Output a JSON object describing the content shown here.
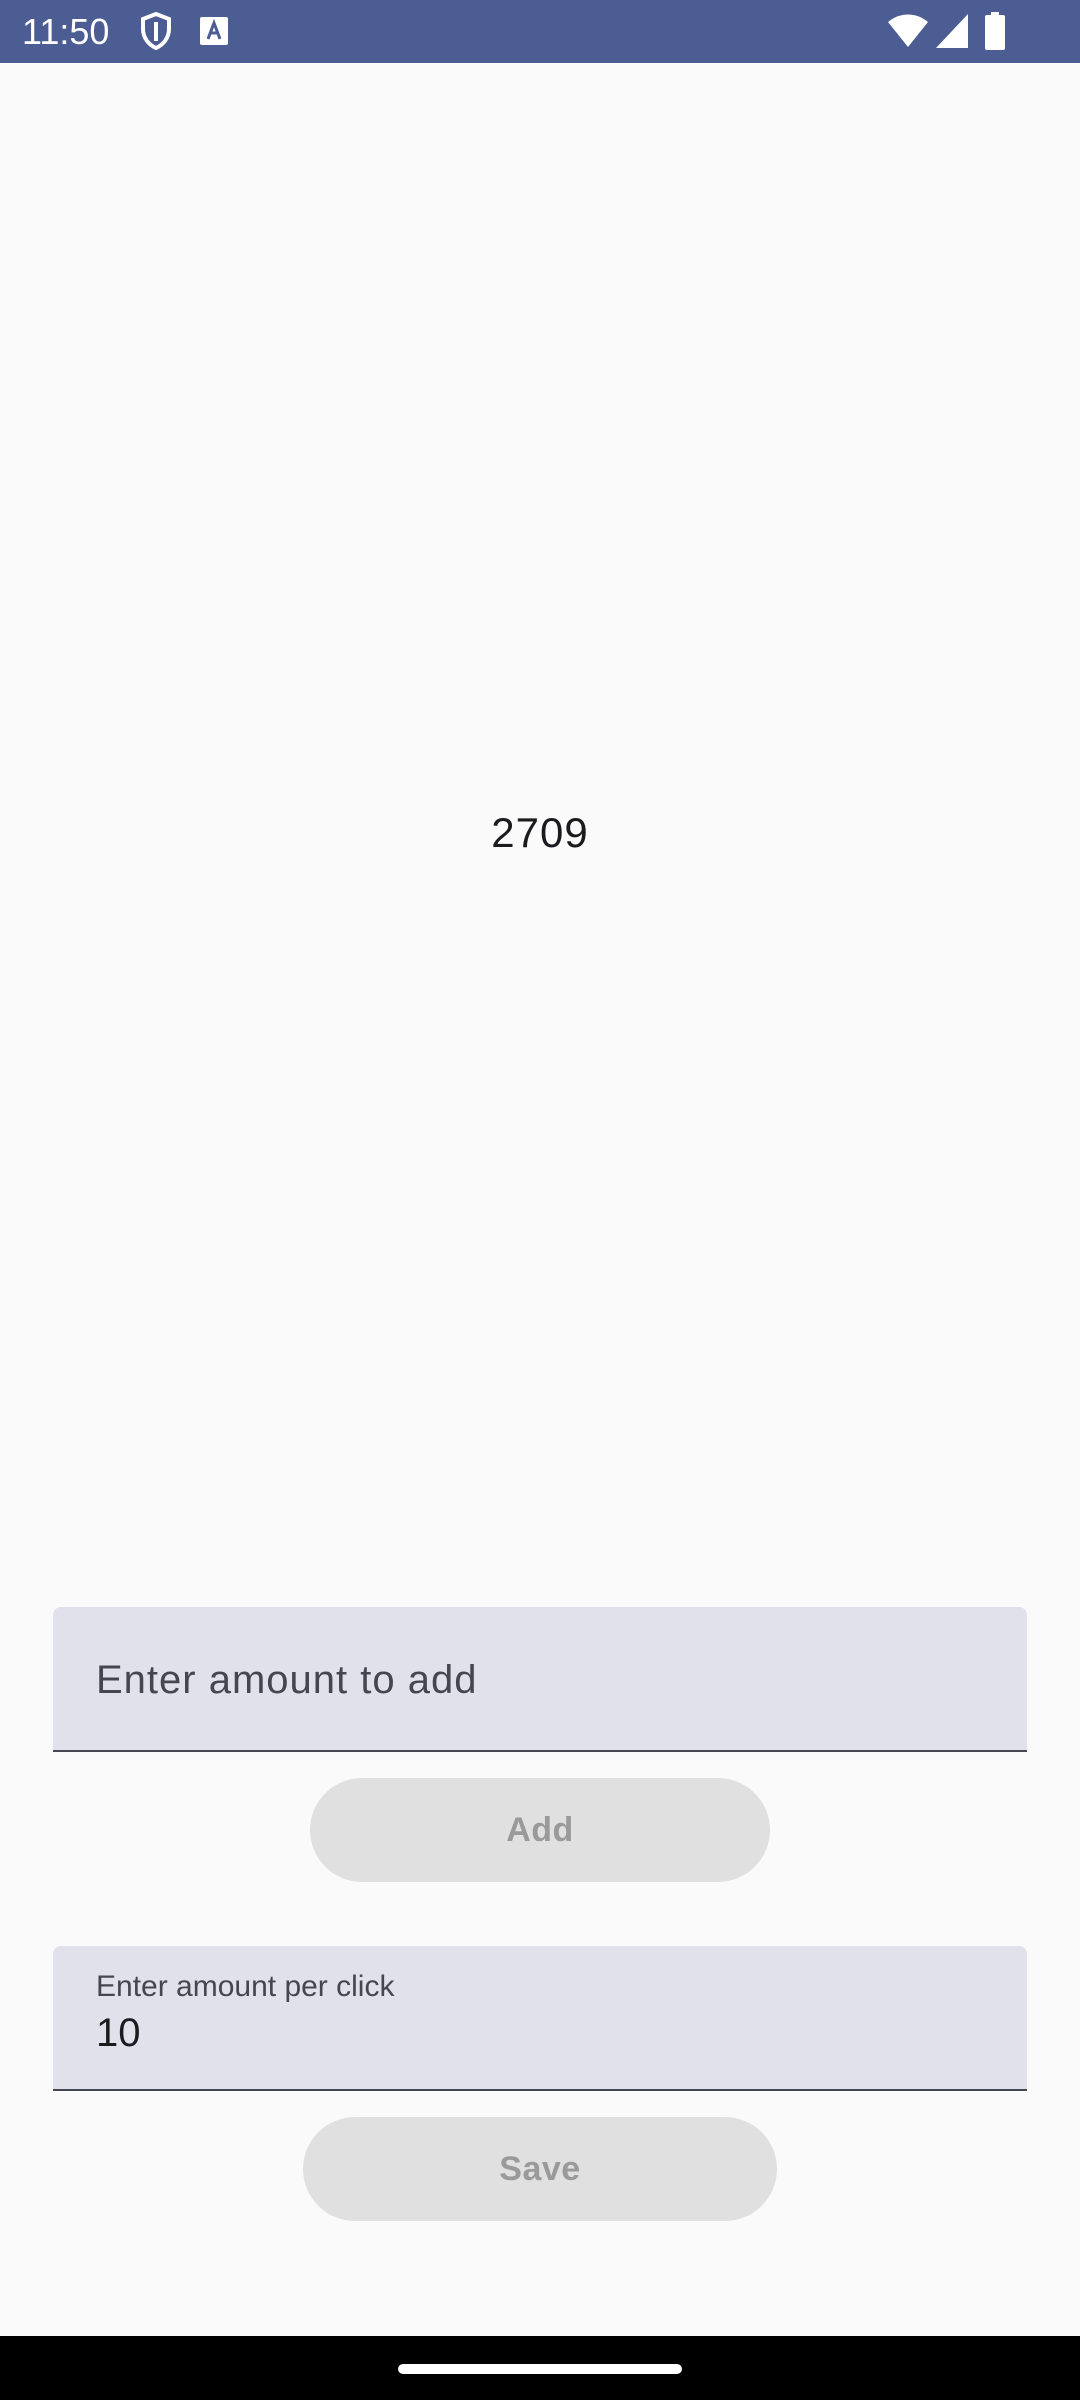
{
  "status_bar": {
    "time": "11:50",
    "background_color": "#4b5d92",
    "left_icons": [
      "shield-icon",
      "text-a-icon"
    ],
    "right_icons": [
      "wifi-icon",
      "cell-signal-icon",
      "battery-icon"
    ]
  },
  "counter": {
    "value": "2709"
  },
  "add_field": {
    "placeholder": "Enter amount to add",
    "value": ""
  },
  "add_button": {
    "label": "Add",
    "enabled": false
  },
  "click_field": {
    "label": "Enter amount per click",
    "value": "10"
  },
  "save_button": {
    "label": "Save",
    "enabled": false
  },
  "colors": {
    "page_background": "#fafafa",
    "field_background": "#e1e1eb",
    "button_disabled_background": "#e0e0e0",
    "button_disabled_text": "#9a9a9a"
  }
}
